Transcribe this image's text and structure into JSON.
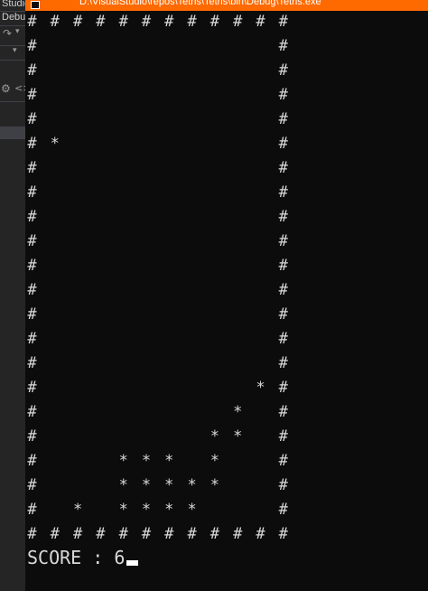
{
  "window": {
    "title": "D:\\VisualStudio\\repos\\Tetris\\Tetris\\bin\\Debug\\Tetris.exe"
  },
  "ide": {
    "labels": [
      "Studio",
      "Debu"
    ],
    "icons": [
      "redo-icon",
      "dropdown-icon",
      "settings-icon",
      "code-icon"
    ]
  },
  "console": {
    "wall_char": "#",
    "block_char": "*",
    "columns": 12,
    "rows": 22,
    "blocks": [
      {
        "row": 5,
        "col": 1
      },
      {
        "row": 15,
        "col": 10
      },
      {
        "row": 16,
        "col": 9
      },
      {
        "row": 17,
        "col": 8
      },
      {
        "row": 17,
        "col": 9
      },
      {
        "row": 18,
        "col": 4
      },
      {
        "row": 18,
        "col": 5
      },
      {
        "row": 18,
        "col": 6
      },
      {
        "row": 18,
        "col": 8
      },
      {
        "row": 19,
        "col": 4
      },
      {
        "row": 19,
        "col": 5
      },
      {
        "row": 19,
        "col": 6
      },
      {
        "row": 19,
        "col": 7
      },
      {
        "row": 19,
        "col": 8
      },
      {
        "row": 20,
        "col": 2
      },
      {
        "row": 20,
        "col": 4
      },
      {
        "row": 20,
        "col": 5
      },
      {
        "row": 20,
        "col": 6
      },
      {
        "row": 20,
        "col": 7
      }
    ],
    "score_label": "SCORE : ",
    "score_value": "6"
  }
}
